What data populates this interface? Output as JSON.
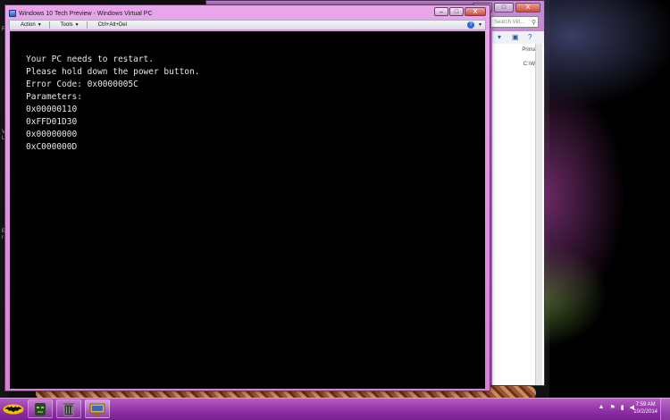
{
  "vpc_window": {
    "title": "Windows 10 Tech Preview - Windows Virtual PC",
    "buttons": {
      "minimize": "–",
      "maximize": "□",
      "close": "X"
    },
    "menu": [
      {
        "label": "Action"
      },
      {
        "label": "Tools"
      },
      {
        "label": "Ctrl+Alt+Del"
      }
    ],
    "help": "?",
    "help_caret": "▼",
    "menu_caret": "▼"
  },
  "guest_screen": {
    "lines": [
      "Your PC needs to restart.",
      "Please hold down the power button.",
      "Error Code: 0x0000005C",
      "Parameters:",
      "0x00000110",
      "0xFFD01D30",
      "0x00000000",
      "0xC000000D"
    ]
  },
  "background_window": {
    "buttons": {
      "minimize": "–",
      "maximize": "□",
      "close": "X"
    },
    "search_placeholder": "Search Virt...",
    "search_icon": "magnifier-icon",
    "column_header": "Primary",
    "row_value": "C:\\Wind"
  },
  "taskbar": {
    "start_icon": "batman-logo-icon",
    "apps": [
      {
        "icon": "green-mask-app-icon"
      },
      {
        "icon": "trash-app-icon"
      },
      {
        "icon": "virtual-pc-icon"
      }
    ],
    "tray": {
      "show_hidden": "▲",
      "flag": "⚑",
      "network": "▮",
      "volume": "◀"
    },
    "clock": {
      "time": "7:59 AM",
      "date": "10/2/2014"
    }
  },
  "colors": {
    "vpc_frame": "#d77fd6",
    "taskbar": "#8e2ea4",
    "guest_bg": "#000000",
    "guest_text": "#e8e8e8"
  }
}
